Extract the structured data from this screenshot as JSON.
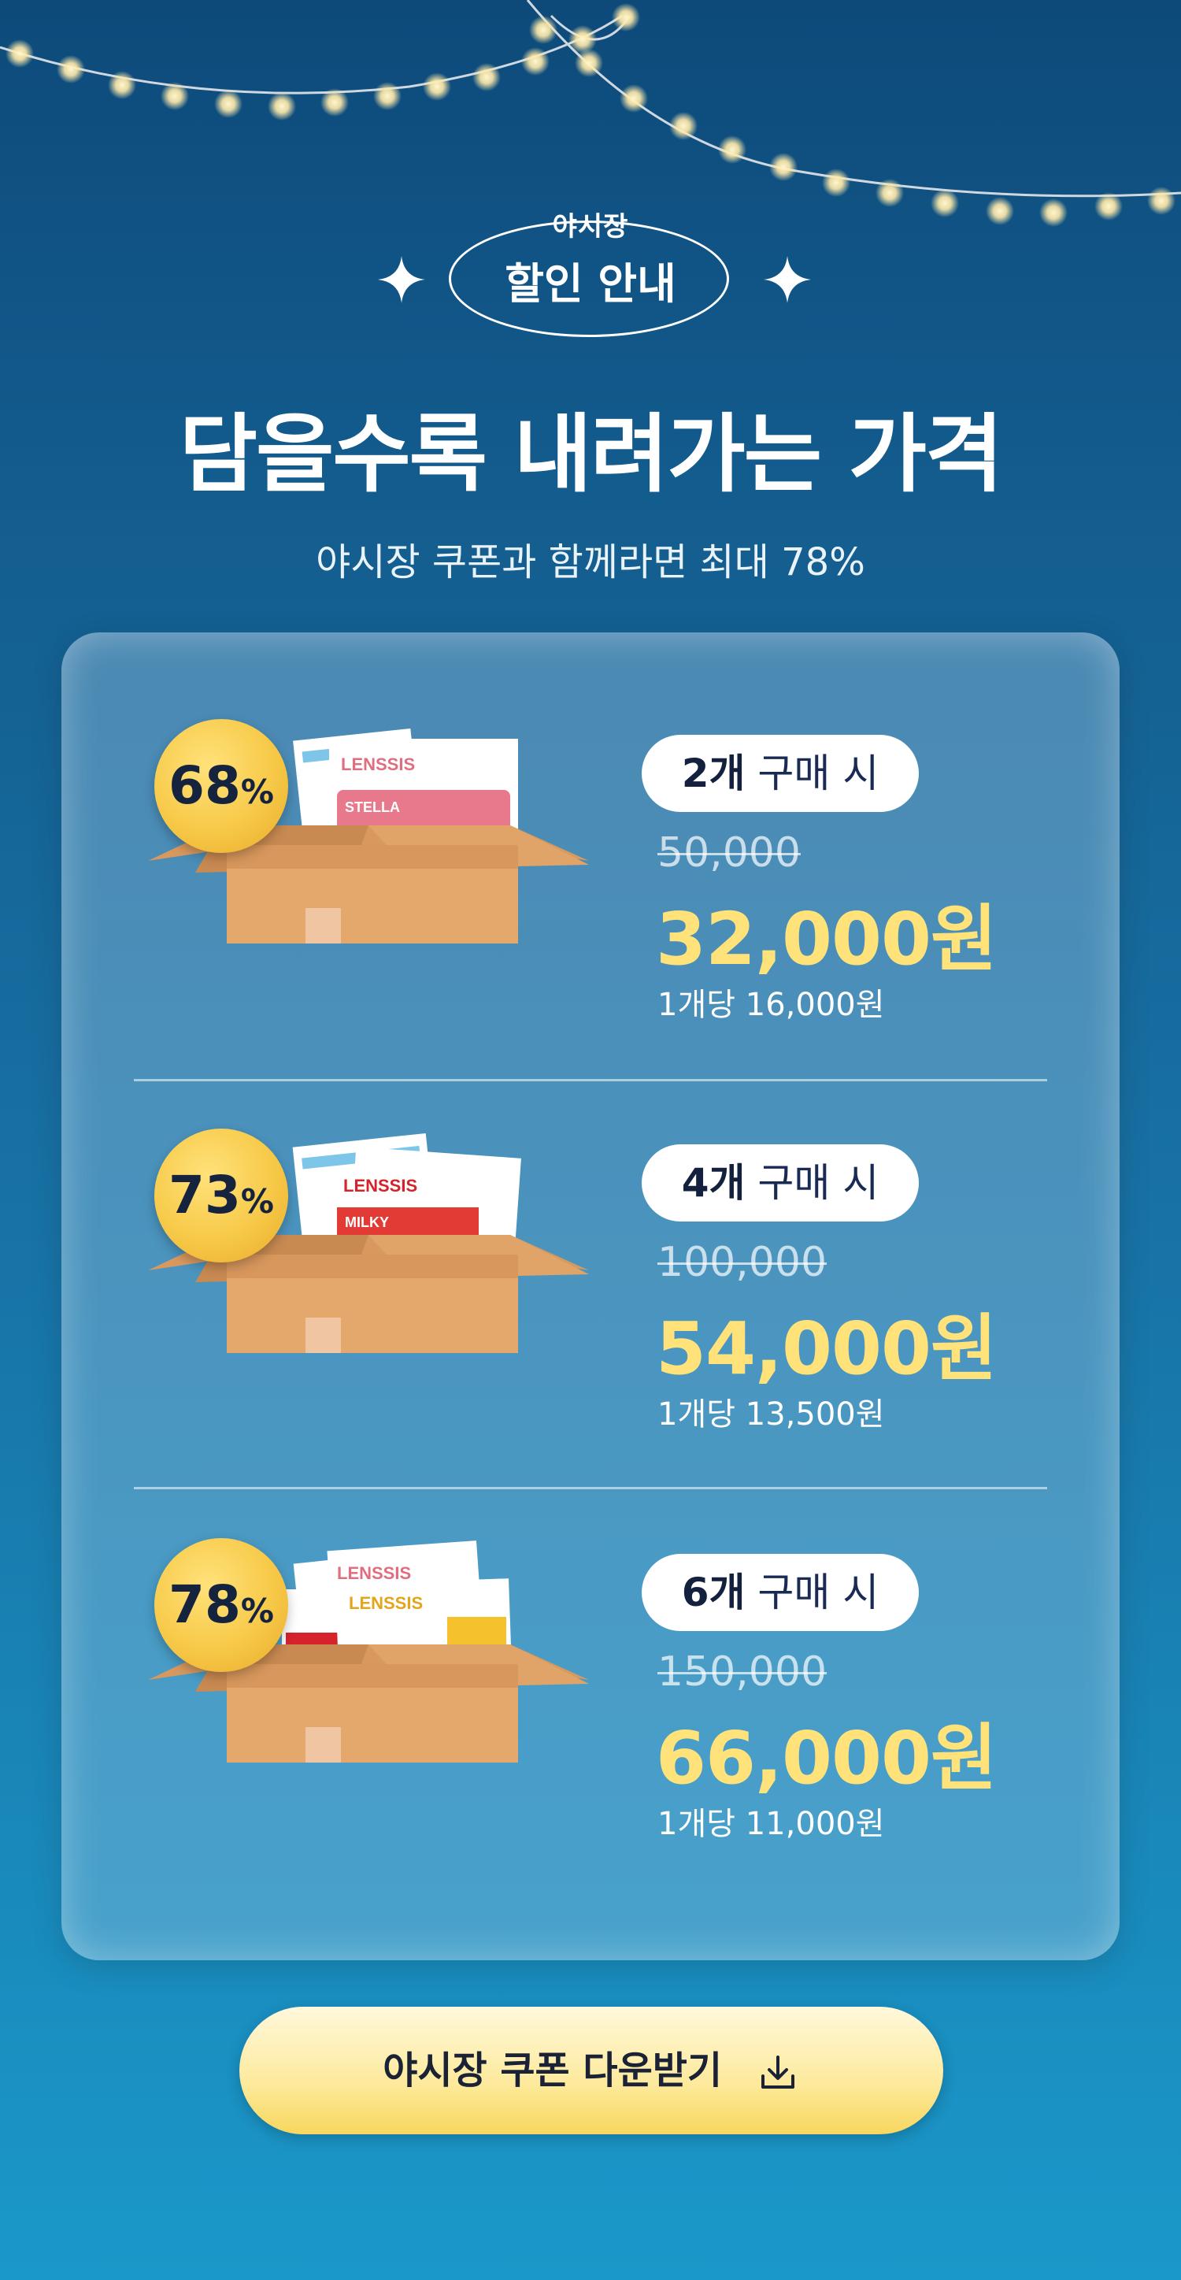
{
  "header": {
    "badge_small": "야시장",
    "badge_big": "할인 안내",
    "headline": "담을수록 내려가는 가격",
    "subline": "야시장 쿠폰과 함께라면 최대 78%"
  },
  "offers": [
    {
      "discount": "68",
      "discount_symbol": "%",
      "qty": "2개",
      "qty_suffix": "구매 시",
      "original_price": "50,000",
      "sale_price": "32,000원",
      "per_unit": "1개당 16,000원",
      "box_brand_labels": [
        "LENSSIS",
        "STELLA"
      ]
    },
    {
      "discount": "73",
      "discount_symbol": "%",
      "qty": "4개",
      "qty_suffix": "구매 시",
      "original_price": "100,000",
      "sale_price": "54,000원",
      "per_unit": "1개당 13,500원",
      "box_brand_labels": [
        "LENSSIS",
        "MILKY"
      ]
    },
    {
      "discount": "78",
      "discount_symbol": "%",
      "qty": "6개",
      "qty_suffix": "구매 시",
      "original_price": "150,000",
      "sale_price": "66,000원",
      "per_unit": "1개당 11,000원",
      "box_brand_labels": [
        "LENSSIS",
        "LENSSIS"
      ]
    }
  ],
  "cta": {
    "label": "야시장 쿠폰 다운받기",
    "icon": "download-icon"
  },
  "colors": {
    "accent_yellow": "#ffe27a",
    "badge_gold": "#f7c948",
    "navy": "#13213f"
  }
}
